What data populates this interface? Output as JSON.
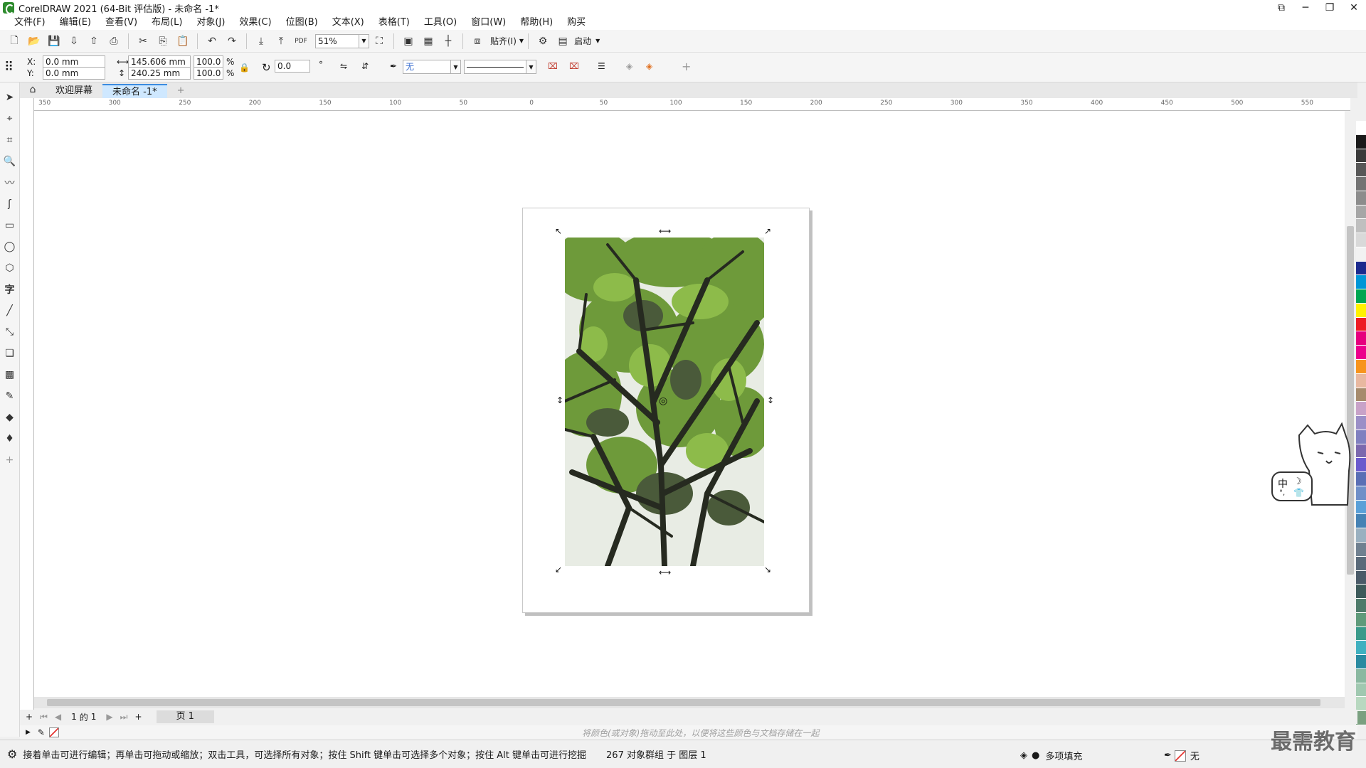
{
  "window": {
    "title": "CorelDRAW 2021 (64-Bit 评估版) - 未命名 -1*"
  },
  "menu": [
    "文件(F)",
    "编辑(E)",
    "查看(V)",
    "布局(L)",
    "对象(J)",
    "效果(C)",
    "位图(B)",
    "文本(X)",
    "表格(T)",
    "工具(O)",
    "窗口(W)",
    "帮助(H)",
    "购买"
  ],
  "toolbar": {
    "zoom": "51%",
    "snap_label": "贴齐(I)",
    "launch_label": "启动"
  },
  "property_bar": {
    "x_label": "X:",
    "x_value": "0.0 mm",
    "y_label": "Y:",
    "y_value": "0.0 mm",
    "width_value": "145.606 mm",
    "height_value": "240.25 mm",
    "scale_w": "100.0",
    "scale_h": "100.0",
    "percent": "%",
    "rotation": "0.0",
    "degree_symbol": "°",
    "fill_value": "无"
  },
  "tabs": [
    {
      "label": "欢迎屏幕",
      "active": false
    },
    {
      "label": "未命名 -1*",
      "active": true
    }
  ],
  "ruler": {
    "h_ticks": [
      "350",
      "300",
      "250",
      "200",
      "150",
      "100",
      "50",
      "0",
      "50",
      "100",
      "150",
      "200",
      "250",
      "300",
      "350",
      "400",
      "450",
      "500",
      "550"
    ],
    "unit": "毫米"
  },
  "page_nav": {
    "current": "1",
    "of_label": "的",
    "total": "1",
    "page_tab": "页 1"
  },
  "hint": "将颜色(或对象)拖动至此处，以便将这些颜色与文档存储在一起",
  "status": {
    "message": "接着单击可进行编辑；再单击可拖动或缩放；双击工具，可选择所有对象；按住 Shift 键单击可选择多个对象；按住 Alt 键单击可进行挖掘",
    "objects": "267 对象群组 于 图层 1",
    "fill": "多项填充",
    "outline": "无"
  },
  "watermark": "最需教育",
  "cat_badge": {
    "lang": "中",
    "moon": "☽"
  },
  "colors": {
    "accent": "#3b8be0",
    "palette": [
      "#ffffff",
      "#1a1a1a",
      "#3a3a3a",
      "#575757",
      "#737373",
      "#8c8c8c",
      "#a6a6a6",
      "#bfbfbf",
      "#d9d9d9",
      "#f2f2f2",
      "#1b2a8e",
      "#0096d6",
      "#00a651",
      "#fff200",
      "#ed1c24",
      "#e6007e",
      "#ec008c",
      "#f7941d",
      "#e8b8a0",
      "#a68b6d",
      "#c8a2c8",
      "#9b8fc7",
      "#8080c0",
      "#7b68ae",
      "#6a5acd",
      "#5a6fb5",
      "#6f8fc8",
      "#5aa0d8",
      "#4682b4",
      "#9ab0c0",
      "#708090",
      "#5a6a7a",
      "#4a5a68",
      "#3d5a5a",
      "#4e7a6a",
      "#5f9a7a",
      "#3a9a8a",
      "#40b0c0",
      "#2a8aa0",
      "#8ab8a0",
      "#a0c8b0",
      "#b8d8c0",
      "#7aa080"
    ]
  }
}
